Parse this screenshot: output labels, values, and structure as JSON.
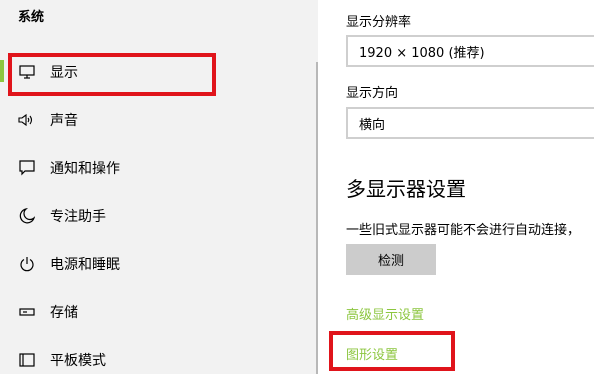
{
  "sidebar": {
    "title": "系统",
    "items": [
      {
        "label": "显示",
        "icon": "monitor-icon"
      },
      {
        "label": "声音",
        "icon": "speaker-icon"
      },
      {
        "label": "通知和操作",
        "icon": "notification-icon"
      },
      {
        "label": "专注助手",
        "icon": "moon-icon"
      },
      {
        "label": "电源和睡眠",
        "icon": "power-icon"
      },
      {
        "label": "存储",
        "icon": "storage-icon"
      },
      {
        "label": "平板模式",
        "icon": "tablet-icon"
      }
    ]
  },
  "main": {
    "resolution_label": "显示分辨率",
    "resolution_value": "1920 × 1080 (推荐)",
    "orientation_label": "显示方向",
    "orientation_value": "横向",
    "multi_display_heading": "多显示器设置",
    "multi_display_desc": "一些旧式显示器可能不会进行自动连接，",
    "detect_button": "检测",
    "advanced_link": "高级显示设置",
    "graphics_link": "图形设置"
  },
  "colors": {
    "accent": "#8dc63f",
    "highlight": "#e0141b",
    "sidebar_bg": "#f2f2f2"
  }
}
